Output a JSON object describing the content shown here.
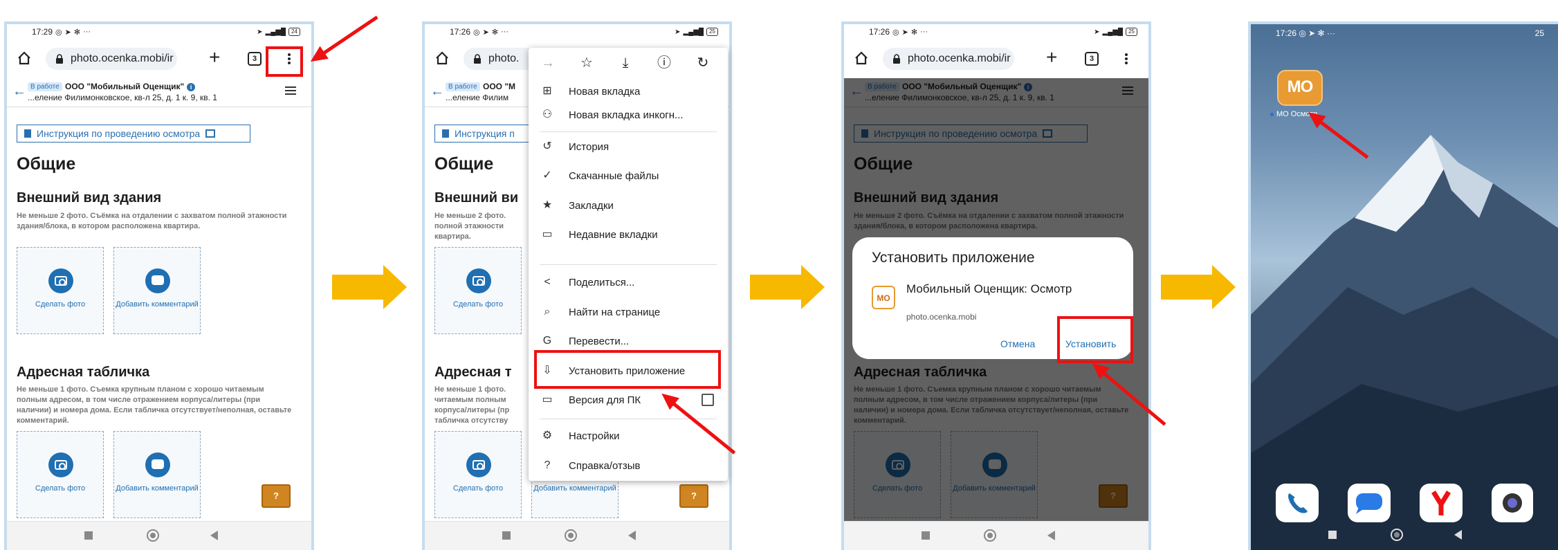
{
  "status_bar": {
    "panel1_time": "17:29",
    "panel2_time": "17:26",
    "panel3_time": "17:26",
    "panel4_time": "17:26",
    "battery1": "24",
    "battery2": "25",
    "battery3": "25",
    "battery4": "25",
    "dots": "···"
  },
  "browser": {
    "url": "photo.ocenka.mobi/ir",
    "url_short": "photo.",
    "tab_count": "3"
  },
  "site": {
    "status_badge": "В работе",
    "org_name": "ООО \"Мобильный Оценщик\"",
    "address": "...еление Филимонковское, кв-л 25, д. 1 к. 9, кв. 1",
    "address_short": "...еление Филим",
    "instruction_link": "Инструкция по проведению осмотра",
    "instruction_short": "Инструкция п",
    "section_title": "Общие",
    "block1_title": "Внешний вид здания",
    "block1_title_short": "Внешний ви",
    "block1_hint": "Не меньше 2 фото. Съёмка на отдалении с захватом полной этажности здания/блока, в котором расположена квартира.",
    "block1_hint_short": "Не меньше 2 фото. полной этажности квартира.",
    "block2_title": "Адресная табличка",
    "block2_title_short": "Адресная т",
    "block2_hint": "Не меньше 1 фото. Съемка крупным планом с хорошо читаемым полным адресом, в том числе отражением корпуса/литеры (при наличии) и номера дома. Если табличка отсутствует/неполная, оставьте комментарий.",
    "block2_hint_short": "Не меньше 1 фото. читаемым полным корпуса/литеры (пр табличка отсутству",
    "take_photo": "Сделать фото",
    "add_comment": "Добавить комментарий",
    "help_button": "?"
  },
  "menu": {
    "items": [
      {
        "label": "Новая вкладка",
        "icon": "plus-box-icon"
      },
      {
        "label": "Новая вкладка инкогн...",
        "icon": "incognito-icon"
      },
      {
        "label": "История",
        "icon": "history-icon"
      },
      {
        "label": "Скачанные файлы",
        "icon": "download-check-icon"
      },
      {
        "label": "Закладки",
        "icon": "star-icon"
      },
      {
        "label": "Недавние вкладки",
        "icon": "devices-icon"
      },
      {
        "label": "Поделиться...",
        "icon": "share-icon"
      },
      {
        "label": "Найти на странице",
        "icon": "find-icon"
      },
      {
        "label": "Перевести...",
        "icon": "translate-icon"
      },
      {
        "label": "Установить приложение",
        "icon": "install-app-icon"
      },
      {
        "label": "Версия для ПК",
        "icon": "desktop-icon"
      },
      {
        "label": "Настройки",
        "icon": "gear-icon"
      },
      {
        "label": "Справка/отзыв",
        "icon": "help-icon"
      }
    ]
  },
  "install_dialog": {
    "title": "Установить приложение",
    "app_name": "Мобильный Оценщик: Осмотр",
    "app_url": "photo.ocenka.mobi",
    "logo_text": "МО",
    "cancel": "Отмена",
    "install": "Установить"
  },
  "home_screen": {
    "app_icon_text": "МО",
    "app_label": "МО Осмотр"
  },
  "colors": {
    "accent": "#1f6fb2",
    "highlight": "#e11111",
    "flow_arrow": "#f7b800",
    "app_orange": "#e89a33"
  }
}
